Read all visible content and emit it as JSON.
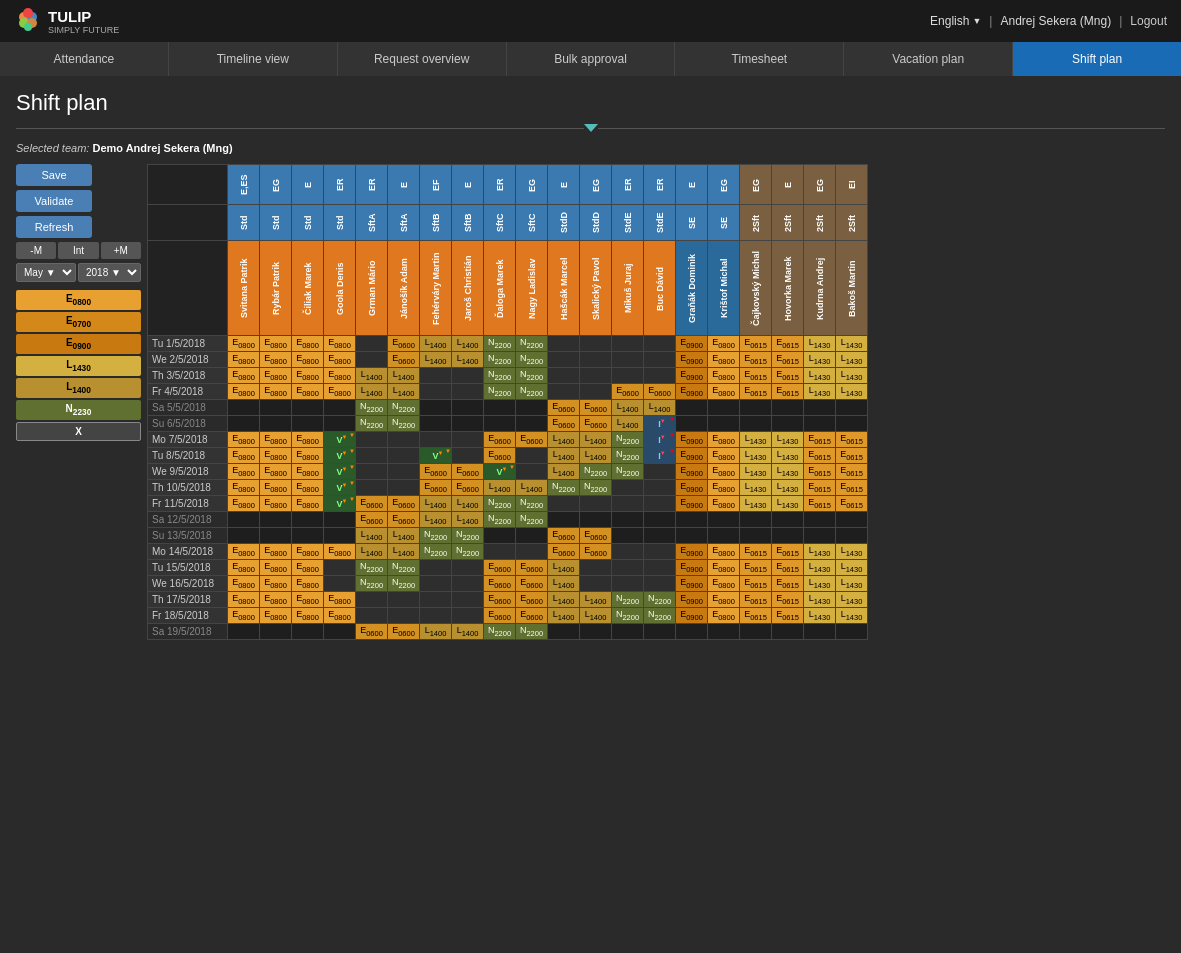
{
  "app": {
    "logo_text": "TULIP",
    "logo_sub": "SIMPLY FUTURE"
  },
  "topbar": {
    "language": "English",
    "user": "Andrej Sekera (Mng)",
    "logout": "Logout"
  },
  "nav": {
    "tabs": [
      {
        "label": "Attendance",
        "active": false
      },
      {
        "label": "Timeline view",
        "active": false
      },
      {
        "label": "Request overview",
        "active": false
      },
      {
        "label": "Bulk approval",
        "active": false
      },
      {
        "label": "Timesheet",
        "active": false
      },
      {
        "label": "Vacation plan",
        "active": false
      },
      {
        "label": "Shift plan",
        "active": true
      }
    ]
  },
  "page": {
    "title": "Shift plan",
    "team_label": "Selected team:",
    "team_value": "Demo Andrej Sekera (Mng)"
  },
  "controls": {
    "save": "Save",
    "validate": "Validate",
    "refresh": "Refresh",
    "minus_m": "-M",
    "int": "Int",
    "plus_m": "+M",
    "month": "May",
    "year": "2018"
  },
  "legend": [
    {
      "label": "E0800",
      "class": "leg-e0800"
    },
    {
      "label": "E0700",
      "class": "leg-e0700"
    },
    {
      "label": "E0900",
      "class": "leg-e0900"
    },
    {
      "label": "L1430",
      "class": "leg-l1430"
    },
    {
      "label": "L1400",
      "class": "leg-l1400"
    },
    {
      "label": "N2230",
      "class": "leg-n2230"
    },
    {
      "label": "X",
      "class": "leg-x"
    }
  ],
  "columns": [
    {
      "code": "E,ES",
      "type": "Std",
      "name": "Svitana Patrik",
      "color": "orange"
    },
    {
      "code": "EG",
      "type": "Std",
      "name": "Rybár Patrik",
      "color": "orange"
    },
    {
      "code": "E",
      "type": "Std",
      "name": "Čiliak Marek",
      "color": "orange"
    },
    {
      "code": "ER",
      "type": "Std",
      "name": "Goola Denis",
      "color": "orange"
    },
    {
      "code": "ER",
      "type": "SftA",
      "name": "Grman Mário",
      "color": "orange"
    },
    {
      "code": "E",
      "type": "SftA",
      "name": "Jánošík Adam",
      "color": "orange"
    },
    {
      "code": "EF",
      "type": "SftB",
      "name": "Fehérváry Martin",
      "color": "orange"
    },
    {
      "code": "E",
      "type": "SftB",
      "name": "Jaroš Christián",
      "color": "orange"
    },
    {
      "code": "ER",
      "type": "SftC",
      "name": "Ďaloga Marek",
      "color": "orange"
    },
    {
      "code": "EG",
      "type": "SftC",
      "name": "Nagy Ladislav",
      "color": "orange"
    },
    {
      "code": "E",
      "type": "StdD",
      "name": "Hašcák Marcel",
      "color": "orange"
    },
    {
      "code": "EG",
      "type": "StdD",
      "name": "Skalický Pavol",
      "color": "orange"
    },
    {
      "code": "ER",
      "type": "StdE",
      "name": "Mikuš Juraj",
      "color": "orange"
    },
    {
      "code": "ER",
      "type": "StdE",
      "name": "Buc Dávid",
      "color": "orange"
    },
    {
      "code": "E",
      "type": "SE",
      "name": "Graňák Dominik",
      "color": "blue"
    },
    {
      "code": "EG",
      "type": "SE",
      "name": "Krištof Michal",
      "color": "blue"
    },
    {
      "code": "EG",
      "type": "2Sft",
      "name": "Čajkovský Michal",
      "color": "brown"
    },
    {
      "code": "E",
      "type": "2Sft",
      "name": "Hovorka Marek",
      "color": "brown"
    },
    {
      "code": "EG",
      "type": "2Sft",
      "name": "Kudrna Andrej",
      "color": "brown"
    },
    {
      "code": "EI",
      "type": "2Sft",
      "name": "Bakoš Martin",
      "color": "brown"
    }
  ],
  "rows": [
    {
      "date": "Tu 1/5/2018",
      "weekend": false,
      "cells": [
        "E0800",
        "E0800",
        "E0800",
        "E0800",
        "",
        "E0600",
        "L1400",
        "L1400",
        "N2200",
        "N2200",
        "",
        "",
        "",
        "",
        "E0900",
        "E0800",
        "E0615",
        "E0615",
        "L1430",
        "L1430"
      ]
    },
    {
      "date": "We 2/5/2018",
      "weekend": false,
      "cells": [
        "E0800",
        "E0800",
        "E0800",
        "E0800",
        "",
        "E0600",
        "L1400",
        "L1400",
        "N2200",
        "N2200",
        "",
        "",
        "",
        "",
        "E0900",
        "E0800",
        "E0615",
        "E0615",
        "L1430",
        "L1430"
      ]
    },
    {
      "date": "Th 3/5/2018",
      "weekend": false,
      "cells": [
        "E0800",
        "E0800",
        "E0800",
        "E0800",
        "L1400",
        "L1400",
        "",
        "",
        "N2200",
        "N2200",
        "",
        "",
        "",
        "",
        "E0900",
        "E0800",
        "E0615",
        "E0615",
        "L1430",
        "L1430"
      ]
    },
    {
      "date": "Fr 4/5/2018",
      "weekend": false,
      "cells": [
        "E0800",
        "E0800",
        "E0800",
        "E0800",
        "L1400",
        "L1400",
        "",
        "",
        "N2200",
        "N2200",
        "",
        "",
        "E0600",
        "E0600",
        "E0900",
        "E0800",
        "E0615",
        "E0615",
        "L1430",
        "L1430"
      ]
    },
    {
      "date": "Sa 5/5/2018",
      "weekend": true,
      "cells": [
        "",
        "",
        "",
        "",
        "N2200",
        "N2200",
        "",
        "",
        "",
        "",
        "E0600",
        "E0600",
        "L1400",
        "L1400",
        "",
        "",
        "",
        "",
        "",
        ""
      ]
    },
    {
      "date": "Su 6/5/2018",
      "weekend": true,
      "cells": [
        "",
        "",
        "",
        "",
        "N2200",
        "N2200",
        "",
        "",
        "",
        "",
        "E0600",
        "E0600",
        "L1400",
        "I",
        "",
        "",
        "",
        "",
        "",
        ""
      ]
    },
    {
      "date": "Mo 7/5/2018",
      "weekend": false,
      "cells": [
        "E0800",
        "E0800",
        "E0800",
        "V",
        "",
        "",
        "",
        "",
        "E0600",
        "E0600",
        "L1400",
        "L1400",
        "N2200",
        "I",
        "E0900",
        "E0800",
        "L1430",
        "L1430",
        "E0615",
        "E0615"
      ]
    },
    {
      "date": "Tu 8/5/2018",
      "weekend": false,
      "cells": [
        "E0800",
        "E0800",
        "E0800",
        "V",
        "",
        "",
        "V",
        "",
        "E0600",
        "",
        "L1400",
        "L1400",
        "N2200",
        "I",
        "E0900",
        "E0800",
        "L1430",
        "L1430",
        "E0615",
        "E0615"
      ]
    },
    {
      "date": "We 9/5/2018",
      "weekend": false,
      "cells": [
        "E0800",
        "E0800",
        "E0800",
        "V",
        "",
        "",
        "E0600",
        "E0600",
        "V",
        "",
        "L1400",
        "N2200",
        "N2200",
        "",
        "E0900",
        "E0800",
        "L1430",
        "L1430",
        "E0615",
        "E0615"
      ]
    },
    {
      "date": "Th 10/5/2018",
      "weekend": false,
      "cells": [
        "E0800",
        "E0800",
        "E0800",
        "V",
        "",
        "",
        "E0600",
        "E0600",
        "L1400",
        "L1400",
        "N2200",
        "N2200",
        "",
        "",
        "E0900",
        "E0800",
        "L1430",
        "L1430",
        "E0615",
        "E0615"
      ]
    },
    {
      "date": "Fr 11/5/2018",
      "weekend": false,
      "cells": [
        "E0800",
        "E0800",
        "E0800",
        "V",
        "E0600",
        "E0600",
        "L1400",
        "L1400",
        "N2200",
        "N2200",
        "",
        "",
        "",
        "",
        "E0900",
        "E0800",
        "L1430",
        "L1430",
        "E0615",
        "E0615"
      ]
    },
    {
      "date": "Sa 12/5/2018",
      "weekend": true,
      "cells": [
        "",
        "",
        "",
        "",
        "E0600",
        "E0600",
        "L1400",
        "L1400",
        "N2200",
        "N2200",
        "",
        "",
        "",
        "",
        "",
        "",
        "",
        "",
        "",
        ""
      ]
    },
    {
      "date": "Su 13/5/2018",
      "weekend": true,
      "cells": [
        "",
        "",
        "",
        "",
        "L1400",
        "L1400",
        "N2200",
        "N2200",
        "",
        "",
        "E0600",
        "E0600",
        "",
        "",
        "",
        "",
        "",
        "",
        "",
        ""
      ]
    },
    {
      "date": "Mo 14/5/2018",
      "weekend": false,
      "cells": [
        "E0800",
        "E0800",
        "E0800",
        "E0800",
        "L1400",
        "L1400",
        "N2200",
        "N2200",
        "",
        "",
        "E0600",
        "E0600",
        "",
        "",
        "E0900",
        "E0800",
        "E0615",
        "E0615",
        "L1430",
        "L1430"
      ]
    },
    {
      "date": "Tu 15/5/2018",
      "weekend": false,
      "cells": [
        "E0800",
        "E0800",
        "E0800",
        "",
        "N2200",
        "N2200",
        "",
        "",
        "E0600",
        "E0600",
        "L1400",
        "",
        "",
        "",
        "E0900",
        "E0800",
        "E0615",
        "E0615",
        "L1430",
        "L1430"
      ]
    },
    {
      "date": "We 16/5/2018",
      "weekend": false,
      "cells": [
        "E0800",
        "E0800",
        "E0800",
        "",
        "N2200",
        "N2200",
        "",
        "",
        "E0600",
        "E0600",
        "L1400",
        "",
        "",
        "",
        "E0900",
        "E0800",
        "E0615",
        "E0615",
        "L1430",
        "L1430"
      ]
    },
    {
      "date": "Th 17/5/2018",
      "weekend": false,
      "cells": [
        "E0800",
        "E0800",
        "E0800",
        "E0800",
        "",
        "",
        "",
        "",
        "E0600",
        "E0600",
        "L1400",
        "L1400",
        "N2200",
        "N2200",
        "E0900",
        "E0800",
        "E0615",
        "E0615",
        "L1430",
        "L1430"
      ]
    },
    {
      "date": "Fr 18/5/2018",
      "weekend": false,
      "cells": [
        "E0800",
        "E0800",
        "E0800",
        "E0800",
        "",
        "",
        "",
        "",
        "E0600",
        "E0600",
        "L1400",
        "L1400",
        "N2200",
        "N2200",
        "E0900",
        "E0800",
        "E0615",
        "E0615",
        "L1430",
        "L1430"
      ]
    },
    {
      "date": "Sa 19/5/2018",
      "weekend": true,
      "cells": [
        "",
        "",
        "",
        "",
        "E0600",
        "E0600",
        "L1400",
        "L1400",
        "N2200",
        "N2200",
        "",
        "",
        "",
        "",
        "",
        "",
        "",
        "",
        "",
        ""
      ]
    }
  ]
}
